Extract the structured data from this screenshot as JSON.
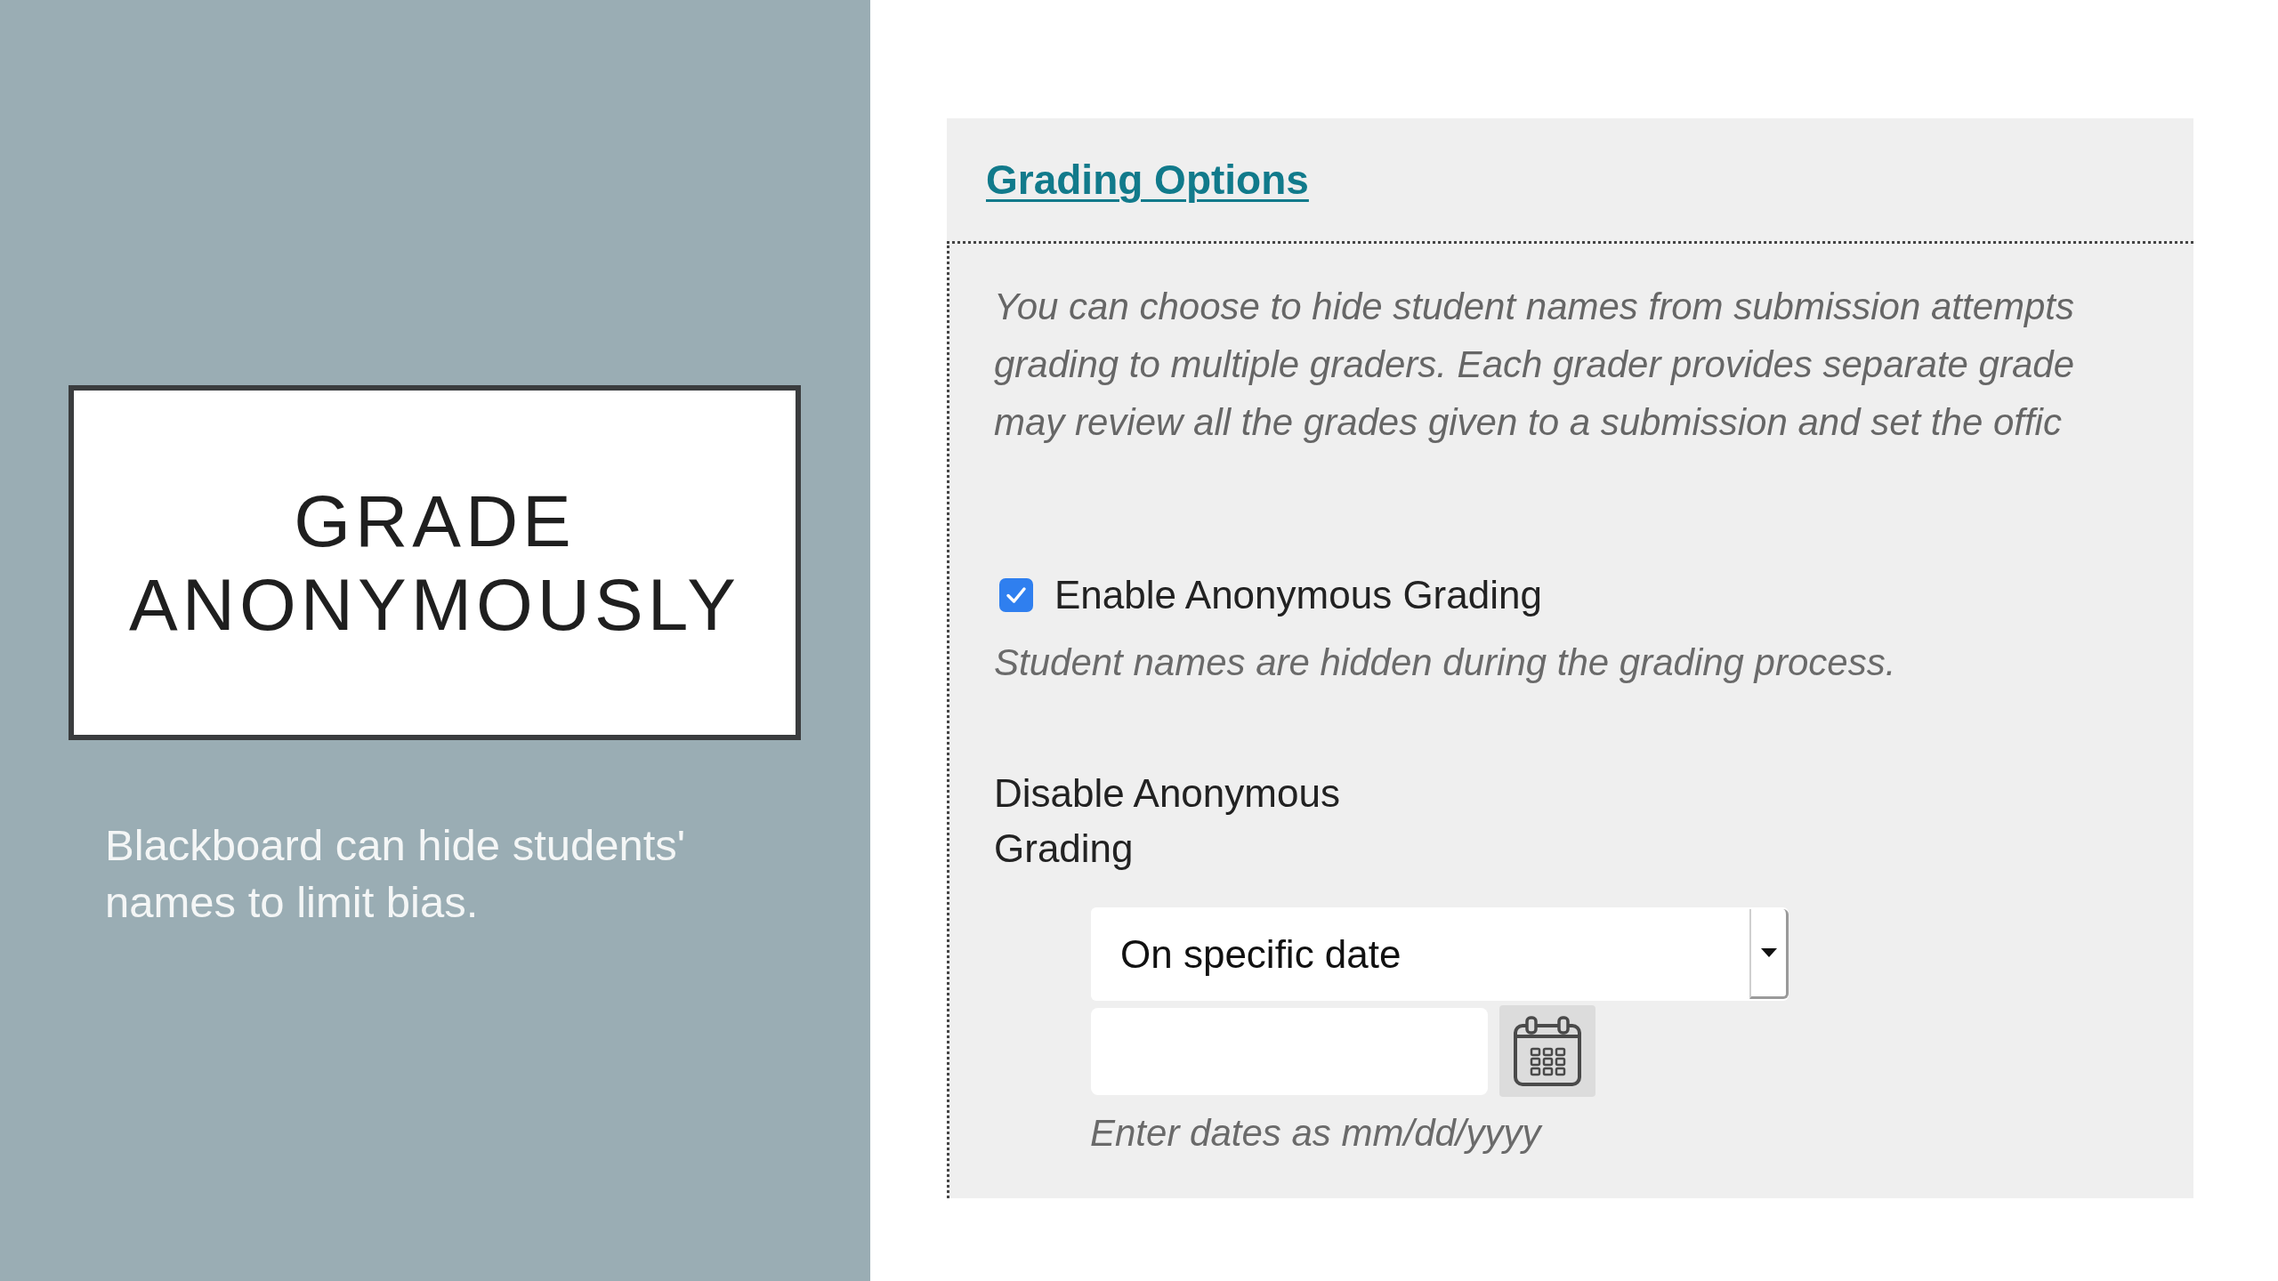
{
  "slide": {
    "title": "GRADE ANONYMOUSLY",
    "caption": "Blackboard can hide students' names to limit bias."
  },
  "grading_options": {
    "heading": "Grading Options",
    "description": "You can choose to hide student names from submission attempts\ngrading to multiple graders. Each grader provides separate grade\nmay review all the grades given to a submission and set the offic",
    "anonymous_checkbox": {
      "label": "Enable Anonymous Grading",
      "checked": true
    },
    "anonymous_hint": "Student names are hidden during the grading process.",
    "disable_label": "Disable Anonymous Grading",
    "disable_select": {
      "value": "On specific date"
    },
    "date_hint": "Enter dates as mm/dd/yyyy"
  }
}
